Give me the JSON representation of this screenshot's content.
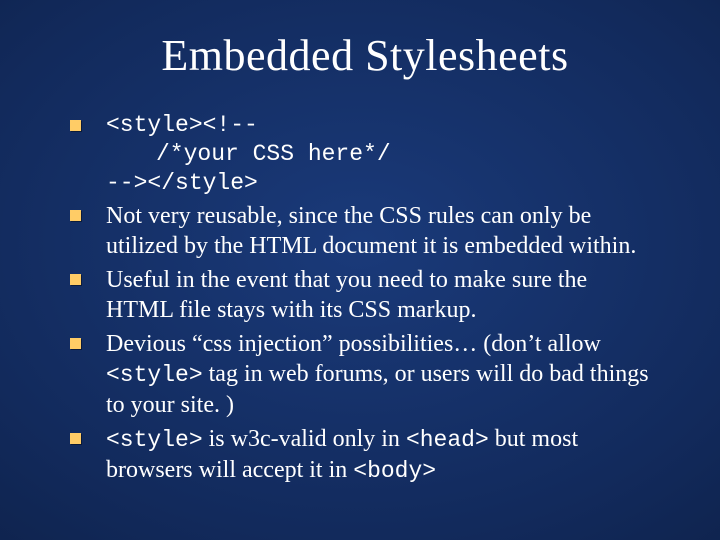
{
  "title": "Embedded Stylesheets",
  "bullets": [
    {
      "line1": "<style><!--",
      "line2": "/*your CSS here*/",
      "line3": "--></style>"
    },
    {
      "text": "Not very reusable, since the CSS rules can only be utilized by the HTML document it is embedded within."
    },
    {
      "text": "Useful in the event that you need to make sure the HTML file stays with its CSS markup."
    },
    {
      "pre": "Devious “css injection” possibilities… (don’t allow ",
      "code": "<style>",
      "post": " tag in web forums, or users will do bad things to your site. )"
    },
    {
      "code1": "<style>",
      "mid1": " is w3c-valid only in ",
      "code2": "<head>",
      "mid2": " but most browsers will accept it in ",
      "code3": "<body>"
    }
  ]
}
